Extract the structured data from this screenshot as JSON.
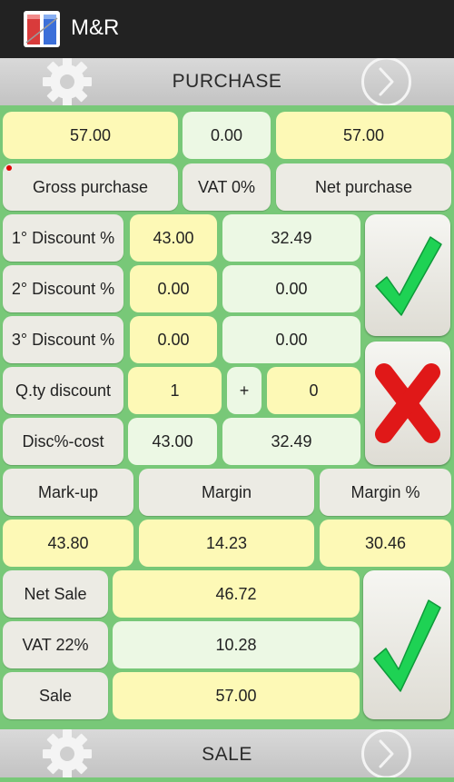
{
  "app": {
    "title": "M&R"
  },
  "headers": {
    "purchase": "PURCHASE",
    "sale": "SALE"
  },
  "purchase": {
    "gross_value": "57.00",
    "vat_value": "0.00",
    "net_value": "57.00",
    "gross_label": "Gross purchase",
    "vat_label": "VAT 0%",
    "net_label": "Net purchase"
  },
  "discounts": [
    {
      "label": "1° Discount %",
      "percent": "43.00",
      "value": "32.49"
    },
    {
      "label": "2° Discount %",
      "percent": "0.00",
      "value": "0.00"
    },
    {
      "label": "3° Discount %",
      "percent": "0.00",
      "value": "0.00"
    }
  ],
  "qty_discount": {
    "label": "Q.ty discount",
    "qty": "1",
    "plus": "+",
    "free": "0"
  },
  "disc_cost": {
    "label": "Disc%-cost",
    "percent": "43.00",
    "value": "32.49"
  },
  "margins": {
    "markup_label": "Mark-up",
    "margin_label": "Margin",
    "margin_pct_label": "Margin %",
    "markup_value": "43.80",
    "margin_value": "14.23",
    "margin_pct_value": "30.46"
  },
  "sale": {
    "net_label": "Net Sale",
    "net_value": "46.72",
    "vat_label": "VAT 22%",
    "vat_value": "10.28",
    "sale_label": "Sale",
    "sale_value": "57.00"
  },
  "colors": {
    "accent_green": "#1ed254",
    "cross_red": "#e01818",
    "panel_bg": "#78c878"
  },
  "icons": {
    "settings": "gear-icon",
    "next": "chevron-right-icon",
    "confirm": "checkmark-icon",
    "cancel": "cross-icon"
  }
}
